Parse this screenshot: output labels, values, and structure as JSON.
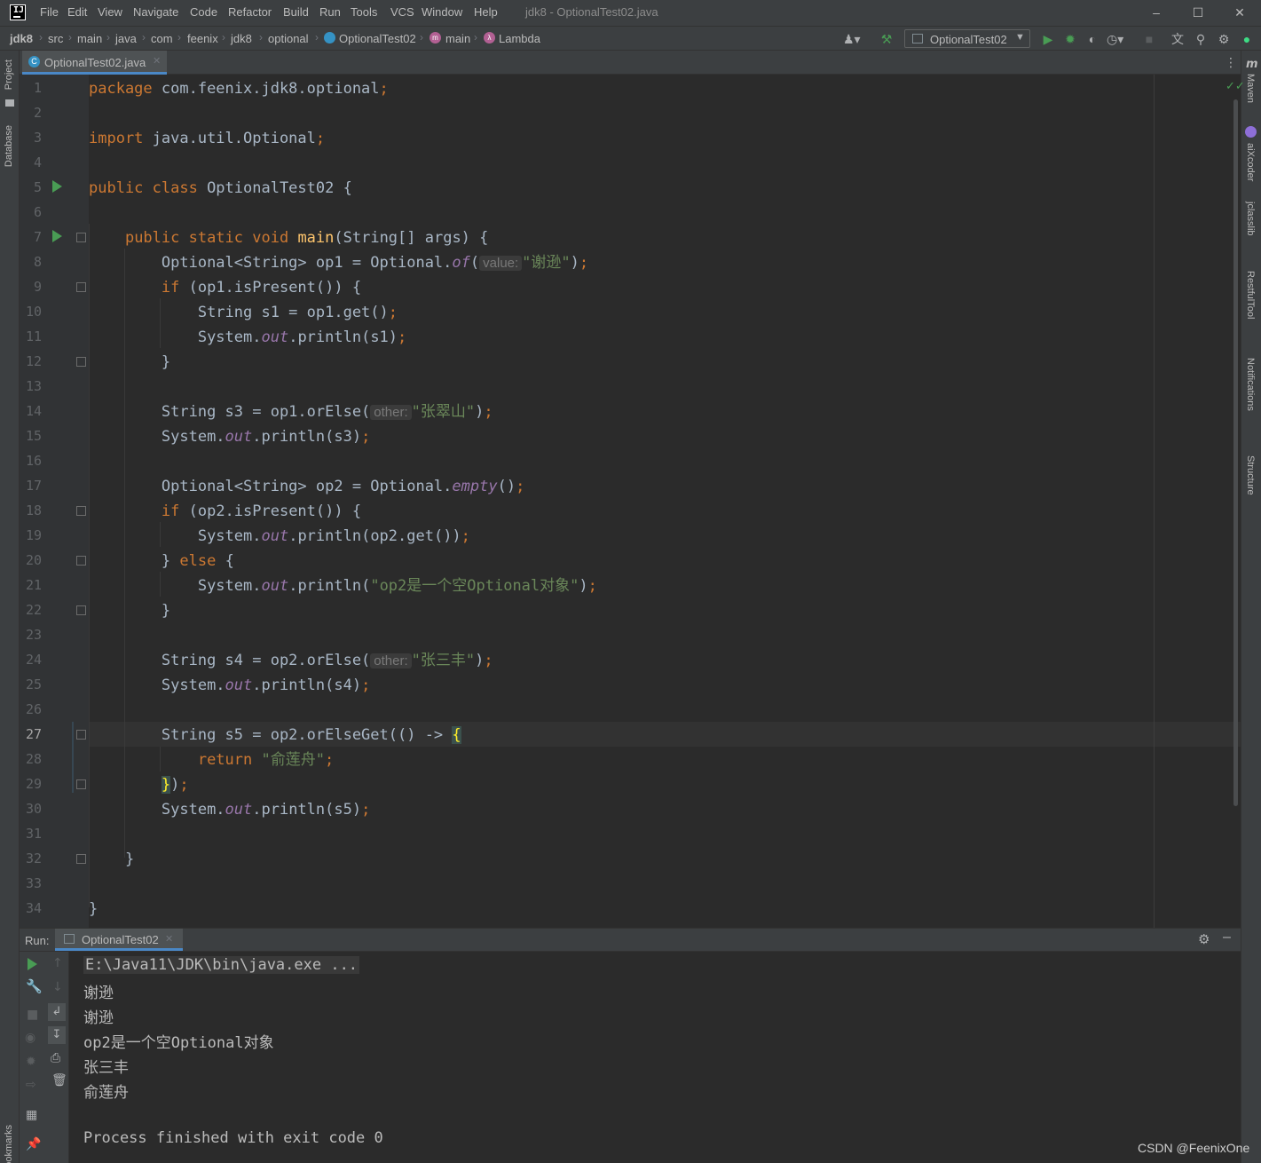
{
  "window": {
    "title": "jdk8 - OptionalTest02.java",
    "app_icon": "IJ",
    "menu": [
      "File",
      "Edit",
      "View",
      "Navigate",
      "Code",
      "Refactor",
      "Build",
      "Run",
      "Tools",
      "VCS",
      "Window",
      "Help"
    ]
  },
  "breadcrumbs": [
    "jdk8",
    "src",
    "main",
    "java",
    "com",
    "feenix",
    "jdk8",
    "optional",
    "OptionalTest02",
    "main",
    "Lambda"
  ],
  "toolbar": {
    "run_config": "OptionalTest02"
  },
  "tabs": [
    {
      "label": "OptionalTest02.java",
      "icon": "java-class-icon",
      "active": true
    }
  ],
  "side_panels": {
    "left": [
      "Project",
      "Database",
      "Bookmarks"
    ],
    "right": [
      "Maven",
      "aiXcoder",
      "jclasslib",
      "RestfulTool",
      "Notifications",
      "Structure"
    ]
  },
  "editor": {
    "current_line": 27,
    "line_numbers": [
      "1",
      "2",
      "3",
      "4",
      "5",
      "6",
      "7",
      "8",
      "9",
      "10",
      "11",
      "12",
      "13",
      "14",
      "15",
      "16",
      "17",
      "18",
      "19",
      "20",
      "21",
      "22",
      "23",
      "24",
      "25",
      "26",
      "27",
      "28",
      "29",
      "30",
      "31",
      "32",
      "33",
      "34"
    ],
    "lines": [
      {
        "t": "kw",
        "v": "package"
      },
      {
        "t": "plain",
        "v": " com.feenix.jdk8.optional"
      },
      {
        "t": "kw",
        "v": ";"
      },
      {
        "t": "kw",
        "v": "import"
      },
      {
        "t": "plain",
        "v": " java.util.Optional"
      },
      {
        "t": "kw",
        "v": ";"
      },
      {
        "t": "kw",
        "v": "public class"
      },
      {
        "t": "plain",
        "v": " OptionalTest02 {"
      },
      {
        "t": "kw",
        "v": "public static void"
      },
      {
        "t": "fn",
        "v": "main"
      },
      {
        "t": "plain",
        "v": "(String[] args) {"
      },
      {
        "t": "plain",
        "v": "Optional<String> op1 = Optional."
      },
      {
        "t": "it",
        "v": "of"
      },
      {
        "t": "plain",
        "v": "("
      },
      {
        "t": "hint",
        "v": "value:"
      },
      {
        "t": "st",
        "v": "\"谢逊\""
      },
      {
        "t": "plain",
        "v": ")"
      },
      {
        "t": "kw",
        "v": ";"
      },
      {
        "t": "kw",
        "v": "if"
      },
      {
        "t": "plain",
        "v": " (op1.isPresent()) {"
      },
      {
        "t": "plain",
        "v": "String s1 = op1.get()"
      },
      {
        "t": "kw",
        "v": ";"
      },
      {
        "t": "plain",
        "v": "System."
      },
      {
        "t": "it",
        "v": "out"
      },
      {
        "t": "plain",
        "v": ".println(s1)"
      },
      {
        "t": "kw",
        "v": ";"
      },
      {
        "t": "plain",
        "v": "}"
      },
      {
        "t": "plain",
        "v": "String s3 = op1.orElse("
      },
      {
        "t": "hint",
        "v": "other:"
      },
      {
        "t": "st",
        "v": "\"张翠山\""
      },
      {
        "t": "plain",
        "v": ")"
      },
      {
        "t": "kw",
        "v": ";"
      },
      {
        "t": "plain",
        "v": "System."
      },
      {
        "t": "it",
        "v": "out"
      },
      {
        "t": "plain",
        "v": ".println(s3)"
      },
      {
        "t": "kw",
        "v": ";"
      },
      {
        "t": "plain",
        "v": "Optional<String> op2 = Optional."
      },
      {
        "t": "it",
        "v": "empty"
      },
      {
        "t": "plain",
        "v": "()"
      },
      {
        "t": "kw",
        "v": ";"
      },
      {
        "t": "kw",
        "v": "if"
      },
      {
        "t": "plain",
        "v": " (op2.isPresent()) {"
      },
      {
        "t": "plain",
        "v": "System."
      },
      {
        "t": "it",
        "v": "out"
      },
      {
        "t": "plain",
        "v": ".println(op2.get())"
      },
      {
        "t": "kw",
        "v": ";"
      },
      {
        "t": "plain",
        "v": "} "
      },
      {
        "t": "kw",
        "v": "else"
      },
      {
        "t": "plain",
        "v": " {"
      },
      {
        "t": "plain",
        "v": "System."
      },
      {
        "t": "it",
        "v": "out"
      },
      {
        "t": "plain",
        "v": ".println("
      },
      {
        "t": "st",
        "v": "\"op2是一个空Optional对象\""
      },
      {
        "t": "plain",
        "v": ")"
      },
      {
        "t": "kw",
        "v": ";"
      },
      {
        "t": "plain",
        "v": "}"
      },
      {
        "t": "plain",
        "v": "String s4 = op2.orElse("
      },
      {
        "t": "hint",
        "v": "other:"
      },
      {
        "t": "st",
        "v": "\"张三丰\""
      },
      {
        "t": "plain",
        "v": ")"
      },
      {
        "t": "kw",
        "v": ";"
      },
      {
        "t": "plain",
        "v": "System."
      },
      {
        "t": "it",
        "v": "out"
      },
      {
        "t": "plain",
        "v": ".println(s4)"
      },
      {
        "t": "kw",
        "v": ";"
      },
      {
        "t": "plain",
        "v": "String s5 = op2.orElseGet(() -> "
      },
      {
        "t": "hl",
        "v": "{"
      },
      {
        "t": "kw",
        "v": "return"
      },
      {
        "t": "st",
        "v": " \"俞莲舟\""
      },
      {
        "t": "kw",
        "v": ";"
      },
      {
        "t": "hl",
        "v": "}"
      },
      {
        "t": "plain",
        "v": ")"
      },
      {
        "t": "kw",
        "v": ";"
      },
      {
        "t": "plain",
        "v": "System."
      },
      {
        "t": "it",
        "v": "out"
      },
      {
        "t": "plain",
        "v": ".println(s5)"
      },
      {
        "t": "kw",
        "v": ";"
      },
      {
        "t": "plain",
        "v": "}"
      },
      {
        "t": "plain",
        "v": "}"
      }
    ]
  },
  "run_panel": {
    "label": "Run:",
    "tab": "OptionalTest02",
    "console": [
      "E:\\Java11\\JDK\\bin\\java.exe ...",
      "谢逊",
      "谢逊",
      "op2是一个空Optional对象",
      "张三丰",
      "俞莲舟",
      "",
      "Process finished with exit code 0"
    ]
  },
  "watermark": "CSDN @FeenixOne",
  "colors": {
    "keyword": "#cc7832",
    "string": "#6a8759",
    "static_field": "#9876aa",
    "method_decl": "#ffc66d",
    "run_green": "#499c54"
  }
}
